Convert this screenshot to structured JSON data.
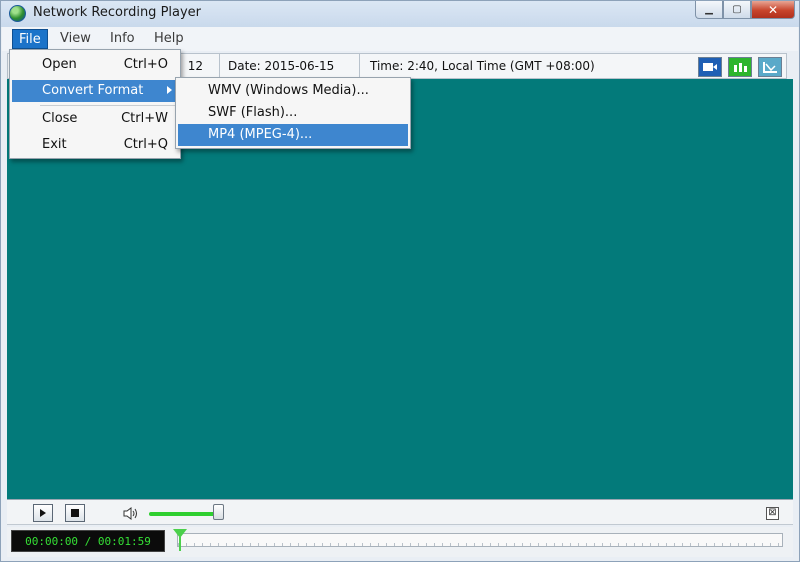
{
  "window": {
    "title": "Network Recording Player",
    "minimize_icon": "minimize-icon",
    "maximize_icon": "maximize-icon",
    "close_icon": "close-icon"
  },
  "menubar": {
    "items": [
      "File",
      "View",
      "Info",
      "Help"
    ],
    "active": "File"
  },
  "infobar": {
    "partial_text": "12",
    "date": "Date: 2015-06-15",
    "time": "Time: 2:40, Local Time (GMT +08:00)",
    "view_buttons": [
      "single-view-icon",
      "grid-view-icon",
      "chart-view-icon"
    ]
  },
  "file_menu": {
    "items": [
      {
        "label": "Open",
        "shortcut": "Ctrl+O"
      },
      {
        "label": "Convert Format",
        "shortcut": "",
        "has_submenu": true
      },
      {
        "label": "Close",
        "shortcut": "Ctrl+W"
      },
      {
        "label": "Exit",
        "shortcut": "Ctrl+Q"
      }
    ]
  },
  "convert_submenu": {
    "items": [
      "WMV (Windows Media)...",
      "SWF (Flash)...",
      "MP4 (MPEG-4)..."
    ],
    "highlighted": "MP4 (MPEG-4)..."
  },
  "controls": {
    "play_icon": "play-icon",
    "stop_icon": "stop-icon",
    "volume_icon": "speaker-icon",
    "volume_level": 0.9,
    "hide_icon": "close-panel-icon",
    "hide_glyph": "⊠"
  },
  "playback": {
    "time_display": "00:00:00 / 00:01:59",
    "position_fraction": 0.0
  },
  "colors": {
    "video_background": "#037a7a",
    "menu_highlight": "#3e86cf",
    "volume": "#2fcf2f",
    "time_text": "#35e035"
  }
}
